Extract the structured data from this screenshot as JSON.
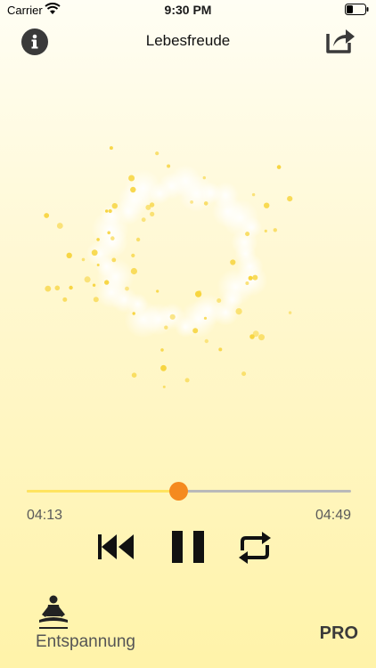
{
  "status_bar": {
    "carrier": "Carrier",
    "time": "9:30 PM",
    "icons": [
      "wifi-icon",
      "battery-icon"
    ]
  },
  "header": {
    "title": "Lebesfreude",
    "info_icon": "info-icon",
    "share_icon": "share-icon"
  },
  "player": {
    "progress_fraction": 0.468,
    "elapsed": "04:13",
    "total": "04:49",
    "controls": [
      "rewind-icon",
      "pause-icon",
      "repeat-icon"
    ]
  },
  "footer": {
    "category_label": "Entspannung",
    "category_icon": "meditation-icon",
    "pro_label": "PRO"
  },
  "colors": {
    "background_top": "#fffef4",
    "background_bottom": "#fff3a9",
    "accent_thumb": "#f58a1f",
    "progress_fill": "#ffe45f",
    "particle": "#f7d43e"
  }
}
